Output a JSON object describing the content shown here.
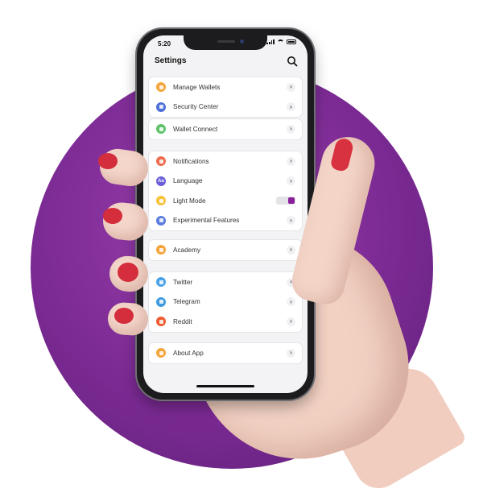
{
  "status_bar": {
    "time": "5:20"
  },
  "header": {
    "title": "Settings",
    "search_icon": "search-icon"
  },
  "groups": [
    {
      "items": [
        {
          "label": "Manage Wallets",
          "icon": "wallet-icon",
          "color": "#f7a43a",
          "control": "chevron"
        },
        {
          "label": "Security Center",
          "icon": "shield-icon",
          "color": "#4d6fd8",
          "control": "chevron"
        }
      ]
    },
    {
      "items": [
        {
          "label": "Wallet Connect",
          "icon": "link-icon",
          "color": "#5cc36a",
          "control": "chevron"
        }
      ]
    },
    {
      "items": [
        {
          "label": "Notifications",
          "icon": "bell-icon",
          "color": "#ee6b4d",
          "control": "chevron"
        },
        {
          "label": "Language",
          "icon": "language-icon",
          "color": "#6a5fd8",
          "control": "chevron",
          "glyph": "Aa"
        },
        {
          "label": "Light Mode",
          "icon": "sun-icon",
          "color": "#f6c33b",
          "control": "toggle",
          "toggle_on": true
        },
        {
          "label": "Experimental Features",
          "icon": "flask-icon",
          "color": "#5c7de0",
          "control": "chevron"
        }
      ]
    },
    {
      "items": [
        {
          "label": "Academy",
          "icon": "academy-icon",
          "color": "#f7a43a",
          "control": "chevron"
        }
      ]
    },
    {
      "items": [
        {
          "label": "Twitter",
          "icon": "twitter-icon",
          "color": "#4aa3e8",
          "control": "chevron"
        },
        {
          "label": "Telegram",
          "icon": "telegram-icon",
          "color": "#3f9be0",
          "control": "chevron"
        },
        {
          "label": "Reddit",
          "icon": "reddit-icon",
          "color": "#ef5a2f",
          "control": "chevron"
        }
      ]
    },
    {
      "items": [
        {
          "label": "About App",
          "icon": "info-icon",
          "color": "#f7a43a",
          "control": "chevron"
        }
      ]
    }
  ],
  "colors": {
    "accent": "#8a1f9b",
    "background_circle": "#7b2a93"
  }
}
